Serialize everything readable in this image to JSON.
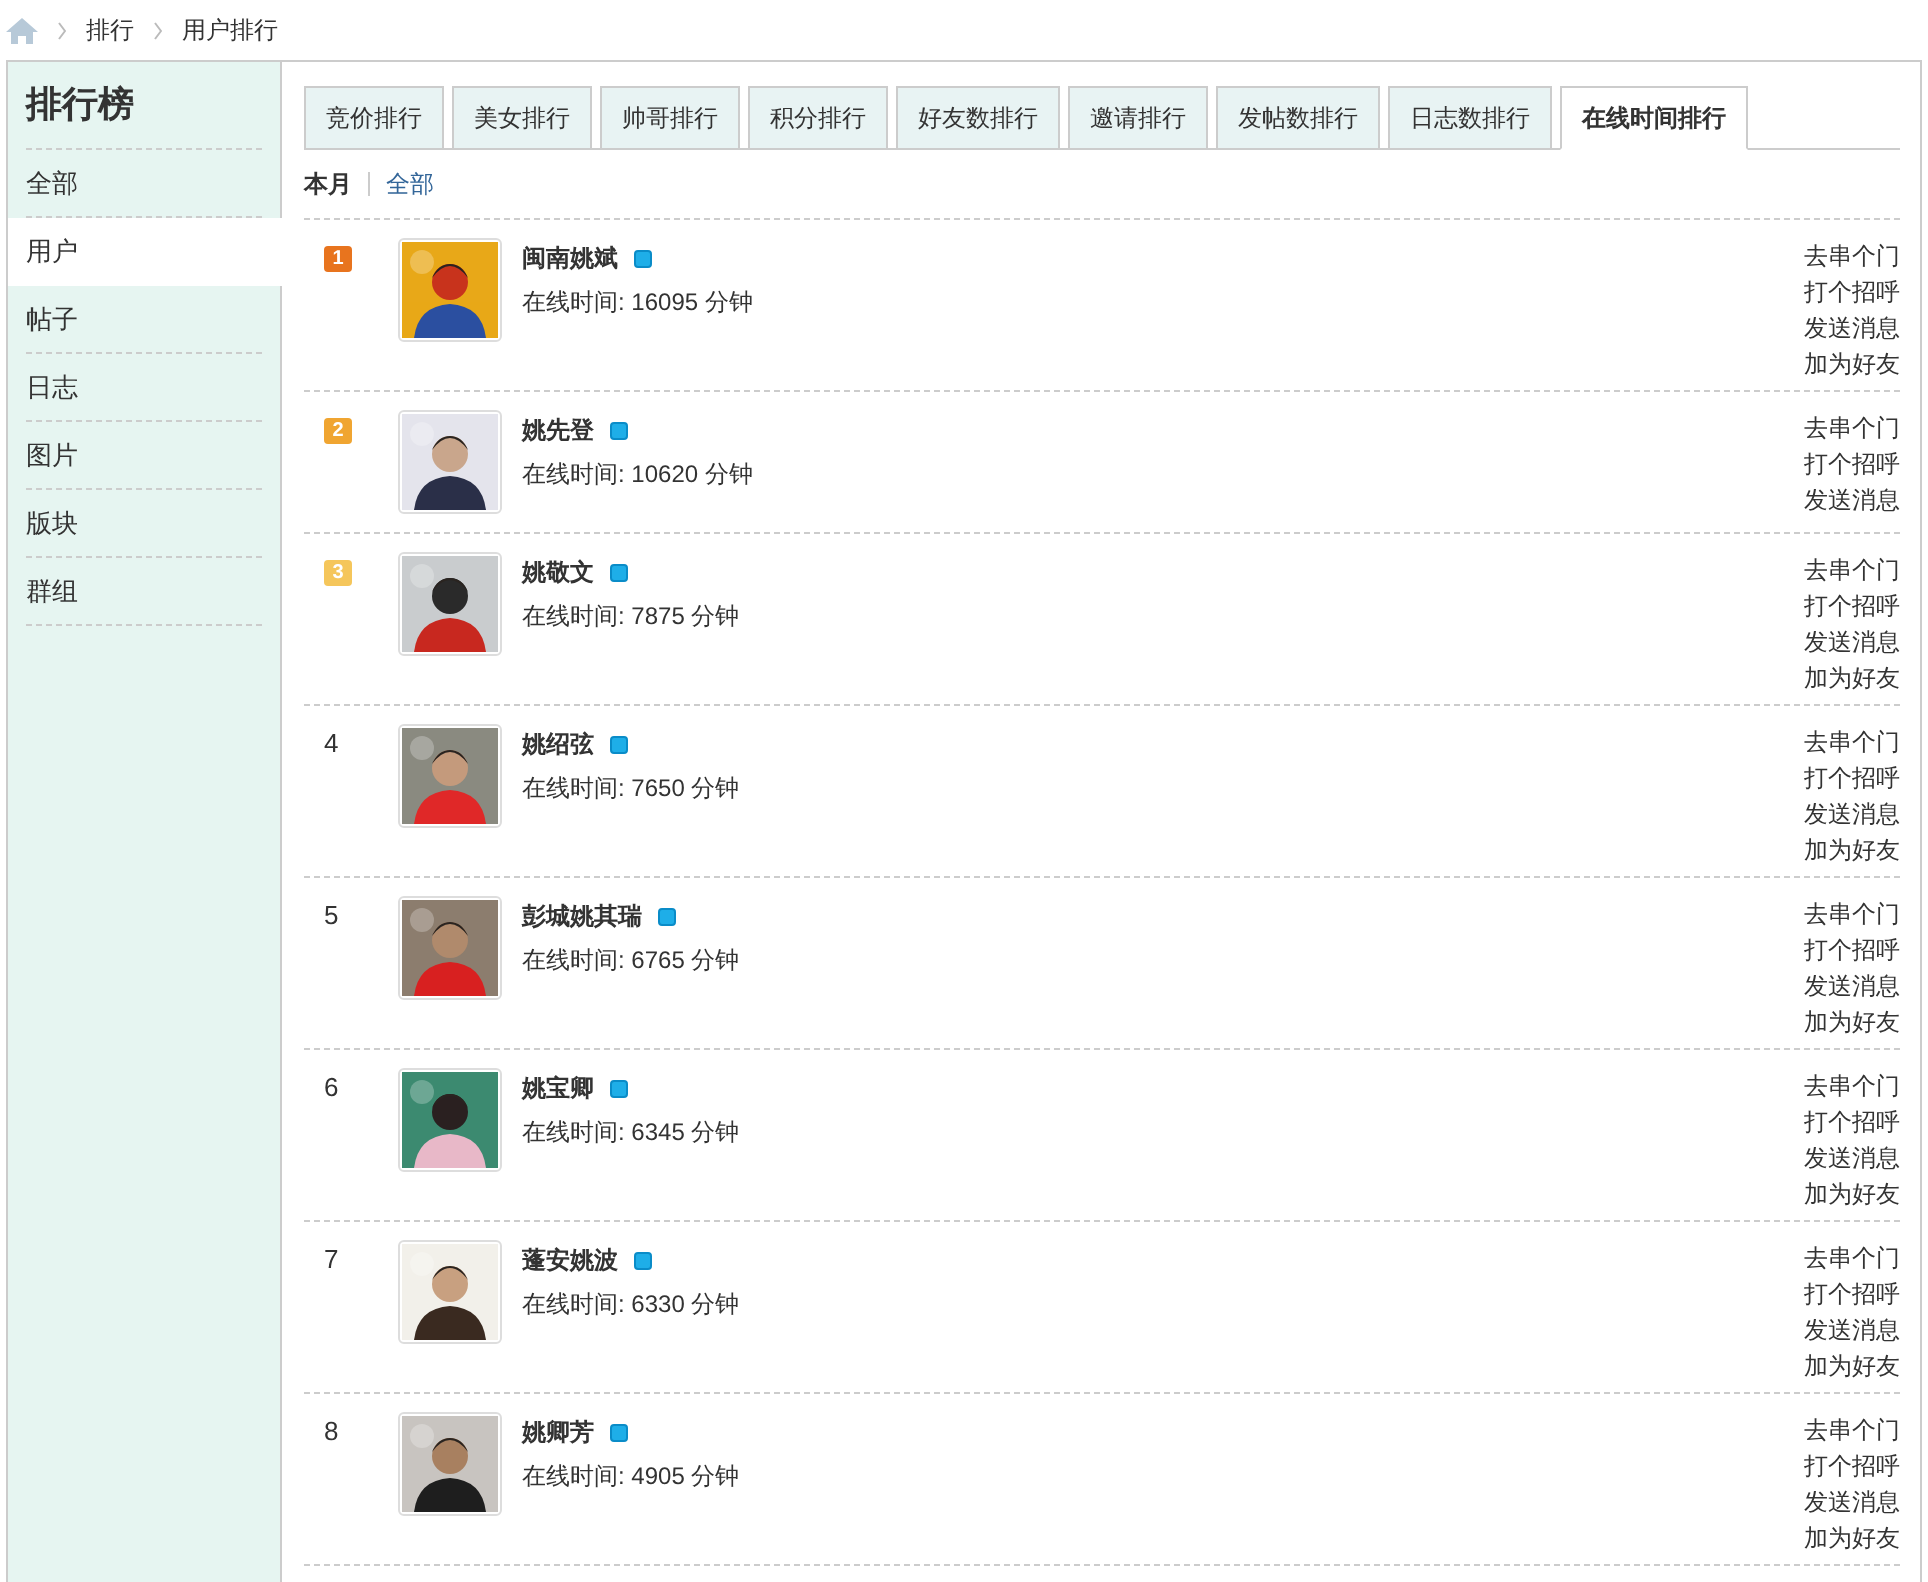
{
  "breadcrumb": [
    "排行",
    "用户排行"
  ],
  "sidebar": {
    "title": "排行榜",
    "items": [
      {
        "label": "全部",
        "selected": false
      },
      {
        "label": "用户",
        "selected": true
      },
      {
        "label": "帖子",
        "selected": false
      },
      {
        "label": "日志",
        "selected": false
      },
      {
        "label": "图片",
        "selected": false
      },
      {
        "label": "版块",
        "selected": false
      },
      {
        "label": "群组",
        "selected": false
      }
    ]
  },
  "tabs": [
    {
      "label": "竞价排行",
      "selected": false
    },
    {
      "label": "美女排行",
      "selected": false
    },
    {
      "label": "帅哥排行",
      "selected": false
    },
    {
      "label": "积分排行",
      "selected": false
    },
    {
      "label": "好友数排行",
      "selected": false
    },
    {
      "label": "邀请排行",
      "selected": false
    },
    {
      "label": "发帖数排行",
      "selected": false
    },
    {
      "label": "日志数排行",
      "selected": false
    },
    {
      "label": "在线时间排行",
      "selected": true
    }
  ],
  "filters": [
    {
      "label": "本月",
      "selected": true
    },
    {
      "label": "全部",
      "selected": false
    }
  ],
  "users": [
    {
      "rank": "1",
      "kind": "badge",
      "color": "#e8741e",
      "name": "闽南姚斌",
      "online": true,
      "time": "在线时间: 16095 分钟",
      "actions": [
        "去串个门",
        "打个招呼",
        "发送消息",
        "加为好友"
      ]
    },
    {
      "rank": "2",
      "kind": "badge",
      "color": "#f0a531",
      "name": "姚先登",
      "online": true,
      "time": "在线时间: 10620 分钟",
      "actions": [
        "去串个门",
        "打个招呼",
        "发送消息"
      ]
    },
    {
      "rank": "3",
      "kind": "badge",
      "color": "#f5c65b",
      "name": "姚敬文",
      "online": true,
      "time": "在线时间: 7875 分钟",
      "actions": [
        "去串个门",
        "打个招呼",
        "发送消息",
        "加为好友"
      ]
    },
    {
      "rank": "4",
      "kind": "plain",
      "name": "姚绍弦",
      "online": true,
      "time": "在线时间: 7650 分钟",
      "actions": [
        "去串个门",
        "打个招呼",
        "发送消息",
        "加为好友"
      ]
    },
    {
      "rank": "5",
      "kind": "plain",
      "name": "彭城姚其瑞",
      "online": true,
      "time": "在线时间: 6765 分钟",
      "actions": [
        "去串个门",
        "打个招呼",
        "发送消息",
        "加为好友"
      ]
    },
    {
      "rank": "6",
      "kind": "plain",
      "name": "姚宝卿",
      "online": true,
      "time": "在线时间: 6345 分钟",
      "actions": [
        "去串个门",
        "打个招呼",
        "发送消息",
        "加为好友"
      ]
    },
    {
      "rank": "7",
      "kind": "plain",
      "name": "蓬安姚波",
      "online": true,
      "time": "在线时间: 6330 分钟",
      "actions": [
        "去串个门",
        "打个招呼",
        "发送消息",
        "加为好友"
      ]
    },
    {
      "rank": "8",
      "kind": "plain",
      "name": "姚卿芳",
      "online": true,
      "time": "在线时间: 4905 分钟",
      "actions": [
        "去串个门",
        "打个招呼",
        "发送消息",
        "加为好友"
      ]
    }
  ]
}
